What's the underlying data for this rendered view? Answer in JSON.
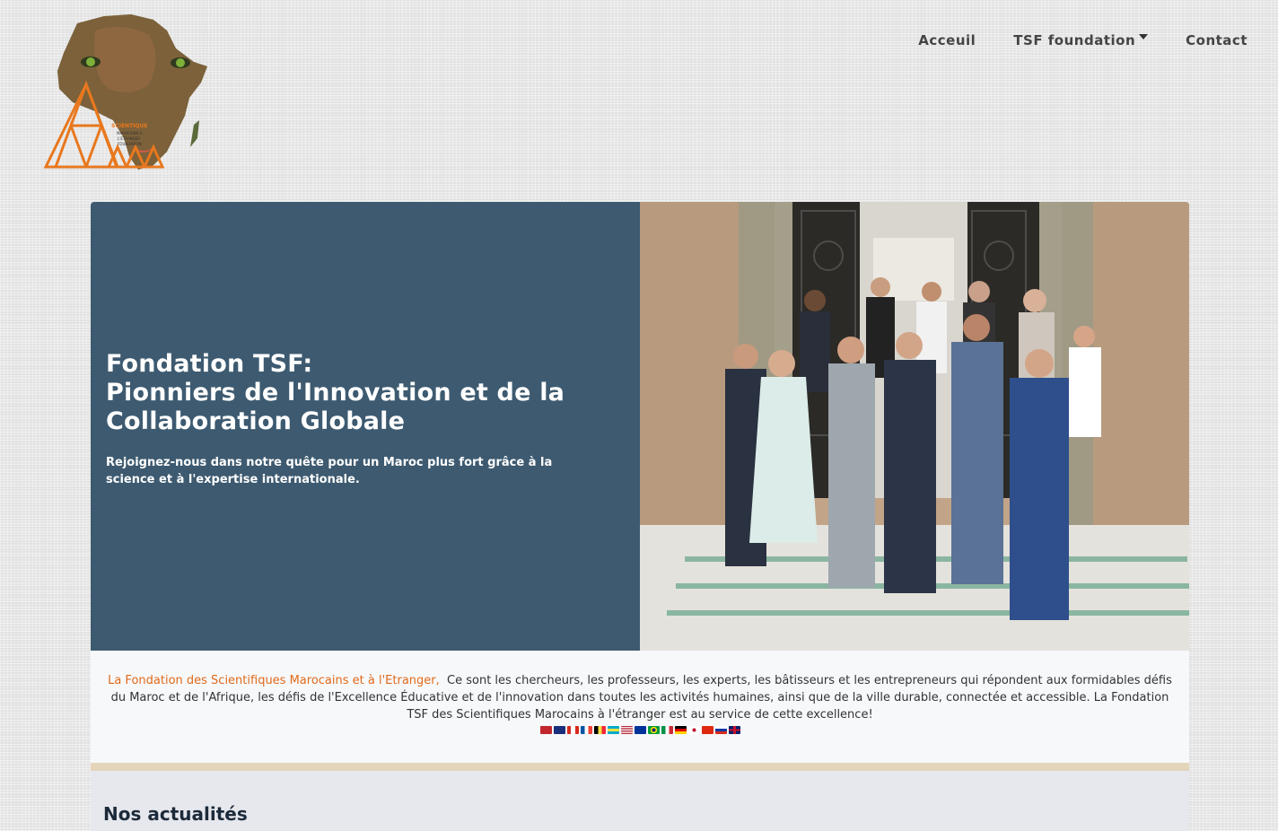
{
  "header": {
    "logo_text": "SCIENTIFIQUE MAROCAINS À L'ETRANGER FOUNDATION",
    "nav": [
      {
        "label": "Acceuil"
      },
      {
        "label": "TSF foundation"
      },
      {
        "label": "Contact"
      }
    ]
  },
  "hero": {
    "title_line1": "Fondation TSF:",
    "title_line2": "Pionniers de l'Innovation et de la",
    "title_line3": "Collaboration Globale",
    "subtitle": "Rejoignez-nous dans notre quête pour un Maroc plus fort grâce à la science et à l'expertise internationale."
  },
  "intro": {
    "lead": "La Fondation des Scientifiques Marocains et à l'Etranger,",
    "body": "Ce sont les chercheurs, les professeurs, les experts, les bâtisseurs et les entrepreneurs qui répondent aux formidables défis du Maroc et de l'Afrique, les défis de l'Excellence Éducative et de l'innovation dans toutes les activités humaines, ainsi que de la ville durable, connectée et accessible. La Fondation TSF des Scientifiques Marocains à l'étranger est au service de cette excellence!",
    "flags": [
      "morocco-flag",
      "australia-flag",
      "canada-flag",
      "france-flag",
      "belgium-flag",
      "bahamas-flag",
      "usa-flag",
      "eu-flag",
      "brazil-flag",
      "italy-flag",
      "germany-flag",
      "japan-flag",
      "china-flag",
      "russia-flag",
      "uk-flag"
    ]
  },
  "news": {
    "title": "Nos actualités"
  },
  "colors": {
    "hero_panel": "#3d5a70",
    "accent_orange": "#e06a1a",
    "divider": "#e4d5ba"
  }
}
